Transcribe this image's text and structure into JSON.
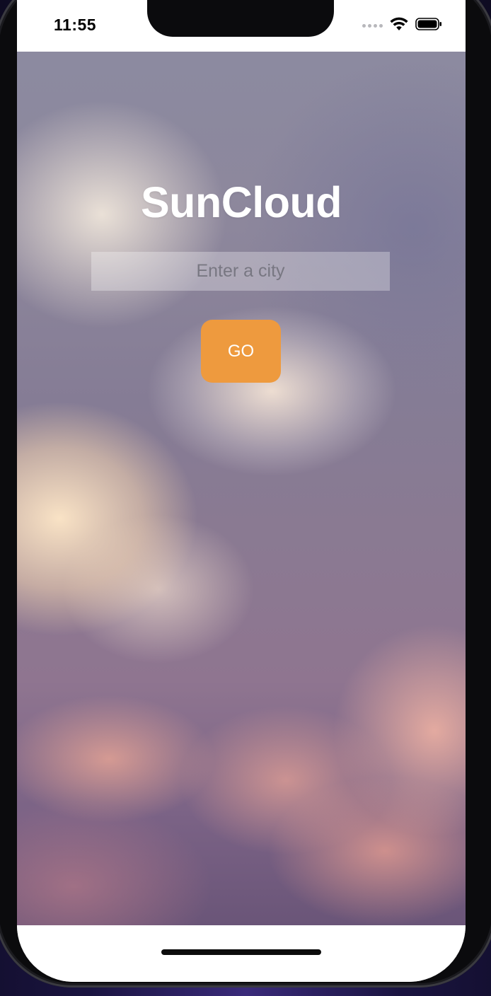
{
  "status_bar": {
    "time": "11:55",
    "cellular_icon": "cellular-dots-icon",
    "wifi_icon": "wifi-icon",
    "battery_icon": "battery-icon"
  },
  "app": {
    "title": "SunCloud",
    "city_input": {
      "value": "",
      "placeholder": "Enter a city"
    },
    "go_button_label": "GO",
    "accent_color": "#ee9a3e"
  }
}
